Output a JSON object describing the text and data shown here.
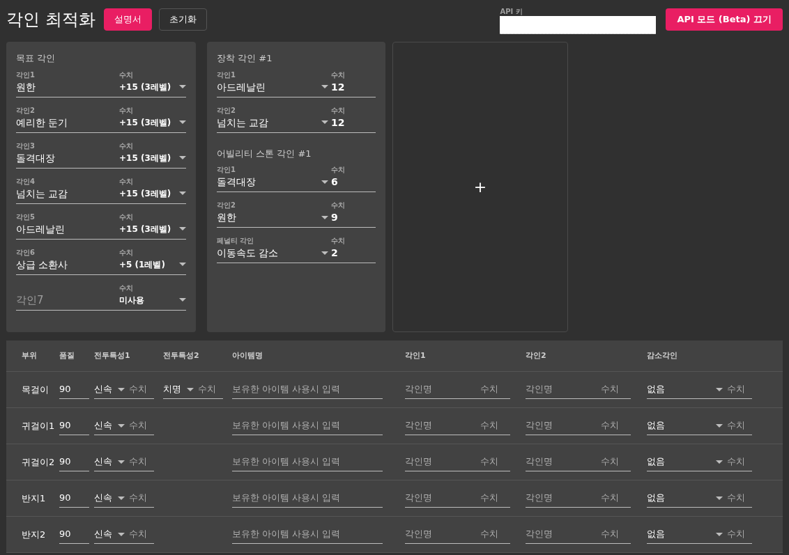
{
  "title": "각인 최적화",
  "header_buttons": [
    {
      "label": "설명서",
      "kind": "primary"
    },
    {
      "label": "초기화",
      "kind": "outlined"
    }
  ],
  "api_key": {
    "label": "API 키"
  },
  "api_button": {
    "label": "API 모드 (Beta) 끄기"
  },
  "target_card": {
    "title": "목표 각인",
    "rows": [
      {
        "label": "각인1",
        "name": "원한",
        "value_label": "수치",
        "value": "+15 (3레벨)"
      },
      {
        "label": "각인2",
        "name": "예리한 둔기",
        "value_label": "수치",
        "value": "+15 (3레벨)"
      },
      {
        "label": "각인3",
        "name": "돌격대장",
        "value_label": "수치",
        "value": "+15 (3레벨)"
      },
      {
        "label": "각인4",
        "name": "넘치는 교감",
        "value_label": "수치",
        "value": "+15 (3레벨)"
      },
      {
        "label": "각인5",
        "name": "아드레날린",
        "value_label": "수치",
        "value": "+15 (3레벨)"
      },
      {
        "label": "각인6",
        "name": "상급 소환사",
        "value_label": "수치",
        "value": "+5 (1레벨)"
      },
      {
        "placeholder": "각인7",
        "value_label": "수치",
        "value": "미사용"
      }
    ]
  },
  "equipped_card": {
    "sections": [
      {
        "title": "장착 각인 #1",
        "rows": [
          {
            "label": "각인1",
            "name": "아드레날린",
            "value_label": "수치",
            "value": "12"
          },
          {
            "label": "각인2",
            "name": "넘치는 교감",
            "value_label": "수치",
            "value": "12"
          }
        ]
      },
      {
        "title": "어빌리티 스톤 각인 #1",
        "rows": [
          {
            "label": "각인1",
            "name": "돌격대장",
            "value_label": "수치",
            "value": "6"
          },
          {
            "label": "각인2",
            "name": "원한",
            "value_label": "수치",
            "value": "9"
          },
          {
            "label": "페널티 각인",
            "name": "이동속도 감소",
            "value_label": "수치",
            "value": "2"
          }
        ]
      }
    ]
  },
  "add_card": {
    "symbol": "+"
  },
  "table": {
    "columns": [
      "부위",
      "품질",
      "전투특성1",
      "전투특성2",
      "아이템명",
      "각인1",
      "각인2",
      "감소각인"
    ],
    "rows": [
      {
        "slot": "목걸이",
        "quality": "90",
        "traits": [
          {
            "value": "신속",
            "amount_placeholder": "수치"
          },
          {
            "value": "치명",
            "amount_placeholder": "수치"
          }
        ],
        "item_placeholder": "보유한 아이템 사용시 입력",
        "engravings": [
          {
            "name_placeholder": "각인명",
            "amount_placeholder": "수치"
          },
          {
            "name_placeholder": "각인명",
            "amount_placeholder": "수치"
          }
        ],
        "penalty": {
          "value": "없음",
          "amount_placeholder": "수치"
        }
      },
      {
        "slot": "귀걸이1",
        "quality": "90",
        "traits": [
          {
            "value": "신속",
            "amount_placeholder": "수치"
          }
        ],
        "item_placeholder": "보유한 아이템 사용시 입력",
        "engravings": [
          {
            "name_placeholder": "각인명",
            "amount_placeholder": "수치"
          },
          {
            "name_placeholder": "각인명",
            "amount_placeholder": "수치"
          }
        ],
        "penalty": {
          "value": "없음",
          "amount_placeholder": "수치"
        }
      },
      {
        "slot": "귀걸이2",
        "quality": "90",
        "traits": [
          {
            "value": "신속",
            "amount_placeholder": "수치"
          }
        ],
        "item_placeholder": "보유한 아이템 사용시 입력",
        "engravings": [
          {
            "name_placeholder": "각인명",
            "amount_placeholder": "수치"
          },
          {
            "name_placeholder": "각인명",
            "amount_placeholder": "수치"
          }
        ],
        "penalty": {
          "value": "없음",
          "amount_placeholder": "수치"
        }
      },
      {
        "slot": "반지1",
        "quality": "90",
        "traits": [
          {
            "value": "신속",
            "amount_placeholder": "수치"
          }
        ],
        "item_placeholder": "보유한 아이템 사용시 입력",
        "engravings": [
          {
            "name_placeholder": "각인명",
            "amount_placeholder": "수치"
          },
          {
            "name_placeholder": "각인명",
            "amount_placeholder": "수치"
          }
        ],
        "penalty": {
          "value": "없음",
          "amount_placeholder": "수치"
        }
      },
      {
        "slot": "반지2",
        "quality": "90",
        "traits": [
          {
            "value": "신속",
            "amount_placeholder": "수치"
          }
        ],
        "item_placeholder": "보유한 아이템 사용시 입력",
        "engravings": [
          {
            "name_placeholder": "각인명",
            "amount_placeholder": "수치"
          },
          {
            "name_placeholder": "각인명",
            "amount_placeholder": "수치"
          }
        ],
        "penalty": {
          "value": "없음",
          "amount_placeholder": "수치"
        }
      }
    ]
  }
}
